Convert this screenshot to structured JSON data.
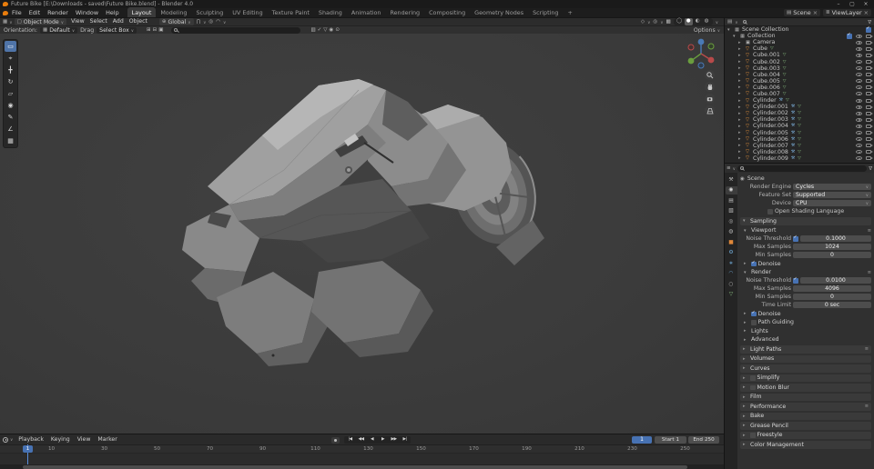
{
  "window": {
    "title": "Future Bike [E:\\Downloads - saved\\Future Bike.blend] - Blender 4.0"
  },
  "topbar": {
    "menus": [
      "File",
      "Edit",
      "Render",
      "Window",
      "Help"
    ],
    "workspaces": [
      {
        "label": "Layout",
        "active": true
      },
      {
        "label": "Modeling"
      },
      {
        "label": "Sculpting"
      },
      {
        "label": "UV Editing"
      },
      {
        "label": "Texture Paint"
      },
      {
        "label": "Shading"
      },
      {
        "label": "Animation"
      },
      {
        "label": "Rendering"
      },
      {
        "label": "Compositing"
      },
      {
        "label": "Geometry Nodes"
      },
      {
        "label": "Scripting"
      },
      {
        "label": "+"
      }
    ],
    "scene_name": "Scene",
    "view_layer_name": "ViewLayer"
  },
  "viewport_header": {
    "mode": "Object Mode",
    "menus": [
      "View",
      "Select",
      "Add",
      "Object"
    ],
    "orientation": "Global",
    "shading_modes": [
      {
        "name": "wireframe"
      },
      {
        "name": "solid",
        "active": true
      },
      {
        "name": "material"
      },
      {
        "name": "rendered"
      }
    ]
  },
  "tool_settings": {
    "orientation_label": "Orientation:",
    "orientation_value": "Default",
    "drag_label": "Drag",
    "tool_value": "Select Box",
    "options_label": "Options"
  },
  "toolbar_tools": [
    "select-box",
    "cursor",
    "move",
    "rotate",
    "scale",
    "transform",
    "annotate",
    "measure",
    "add-cube"
  ],
  "outliner": {
    "root_label": "Scene Collection",
    "collection_label": "Collection",
    "rows": [
      {
        "name": "Camera",
        "icon": "camera",
        "has_mod": false,
        "has_data": false
      },
      {
        "name": "Cube",
        "icon": "mesh",
        "has_mod": false,
        "has_data": true
      },
      {
        "name": "Cube.001",
        "icon": "mesh",
        "has_mod": false,
        "has_data": true
      },
      {
        "name": "Cube.002",
        "icon": "mesh",
        "has_mod": false,
        "has_data": true
      },
      {
        "name": "Cube.003",
        "icon": "mesh",
        "has_mod": false,
        "has_data": true
      },
      {
        "name": "Cube.004",
        "icon": "mesh",
        "has_mod": false,
        "has_data": true
      },
      {
        "name": "Cube.005",
        "icon": "mesh",
        "has_mod": false,
        "has_data": true
      },
      {
        "name": "Cube.006",
        "icon": "mesh",
        "has_mod": false,
        "has_data": true
      },
      {
        "name": "Cube.007",
        "icon": "mesh",
        "has_mod": false,
        "has_data": true
      },
      {
        "name": "Cylinder",
        "icon": "mesh",
        "has_mod": true,
        "has_data": true
      },
      {
        "name": "Cylinder.001",
        "icon": "mesh",
        "has_mod": true,
        "has_data": true
      },
      {
        "name": "Cylinder.002",
        "icon": "mesh",
        "has_mod": true,
        "has_data": true
      },
      {
        "name": "Cylinder.003",
        "icon": "mesh",
        "has_mod": true,
        "has_data": true
      },
      {
        "name": "Cylinder.004",
        "icon": "mesh",
        "has_mod": true,
        "has_data": true
      },
      {
        "name": "Cylinder.005",
        "icon": "mesh",
        "has_mod": true,
        "has_data": true
      },
      {
        "name": "Cylinder.006",
        "icon": "mesh",
        "has_mod": true,
        "has_data": true
      },
      {
        "name": "Cylinder.007",
        "icon": "mesh",
        "has_mod": true,
        "has_data": true
      },
      {
        "name": "Cylinder.008",
        "icon": "mesh",
        "has_mod": true,
        "has_data": true
      },
      {
        "name": "Cylinder.009",
        "icon": "mesh",
        "has_mod": true,
        "has_data": true
      }
    ]
  },
  "prop_tabs": [
    {
      "name": "tool",
      "glyph": "⚒",
      "color": "#b9b9b9"
    },
    {
      "name": "render",
      "glyph": "◉",
      "color": "#d9d9d9",
      "active": true
    },
    {
      "name": "output",
      "glyph": "▤",
      "color": "#b9b9b9"
    },
    {
      "name": "view-layer",
      "glyph": "▧",
      "color": "#b9b9b9"
    },
    {
      "name": "scene",
      "glyph": "◎",
      "color": "#b9b9b9"
    },
    {
      "name": "world",
      "glyph": "◍",
      "color": "#b9b9b9"
    },
    {
      "name": "object",
      "glyph": "■",
      "color": "#e0883a"
    },
    {
      "name": "modifiers",
      "glyph": "⚙",
      "color": "#6fa8d4"
    },
    {
      "name": "particles",
      "glyph": "∗",
      "color": "#6fa8d4"
    },
    {
      "name": "physics",
      "glyph": "◠",
      "color": "#6fa8d4"
    },
    {
      "name": "constraints",
      "glyph": "○",
      "color": "#b9b9b9"
    },
    {
      "name": "data",
      "glyph": "▽",
      "color": "#86b97e"
    }
  ],
  "properties": {
    "breadcrumb": "Scene",
    "render_engine_label": "Render Engine",
    "render_engine": "Cycles",
    "feature_set_label": "Feature Set",
    "feature_set": "Supported",
    "device_label": "Device",
    "device": "CPU",
    "osl_label": "Open Shading Language",
    "sampling_label": "Sampling",
    "viewport_label": "Viewport",
    "vp_noise_label": "Noise Threshold",
    "vp_noise": "0.1000",
    "vp_max_label": "Max Samples",
    "vp_max": "1024",
    "vp_min_label": "Min Samples",
    "vp_min": "0",
    "denoise_label": "Denoise",
    "render_label": "Render",
    "r_noise_label": "Noise Threshold",
    "r_noise": "0.0100",
    "r_max_label": "Max Samples",
    "r_max": "4096",
    "r_min_label": "Min Samples",
    "r_min": "0",
    "time_limit_label": "Time Limit",
    "time_limit": "0 sec",
    "sampling_extras": [
      {
        "label": "Path Guiding",
        "checkbox": true,
        "checked": false
      },
      {
        "label": "Lights"
      },
      {
        "label": "Advanced"
      }
    ],
    "sections": [
      {
        "label": "Light Paths",
        "preset": true
      },
      {
        "label": "Volumes"
      },
      {
        "label": "Curves"
      },
      {
        "label": "Simplify",
        "checkbox": true,
        "checked": false
      },
      {
        "label": "Motion Blur",
        "checkbox": true,
        "checked": false
      },
      {
        "label": "Film"
      },
      {
        "label": "Performance",
        "preset": true
      },
      {
        "label": "Bake"
      },
      {
        "label": "Grease Pencil"
      },
      {
        "label": "Freestyle",
        "checkbox": true,
        "checked": false
      },
      {
        "label": "Color Management"
      }
    ]
  },
  "timeline": {
    "menus": [
      "Playback",
      "Keying",
      "View",
      "Marker"
    ],
    "transport": [
      "jump-start",
      "prev-keyframe",
      "play-reverse",
      "play",
      "next-keyframe",
      "jump-end"
    ],
    "current_frame": "1",
    "start_label": "Start",
    "start_value": "1",
    "end_label": "End",
    "end_value": "250",
    "ticks": [
      10,
      30,
      50,
      70,
      90,
      110,
      130,
      150,
      170,
      190,
      210,
      230,
      250
    ]
  }
}
